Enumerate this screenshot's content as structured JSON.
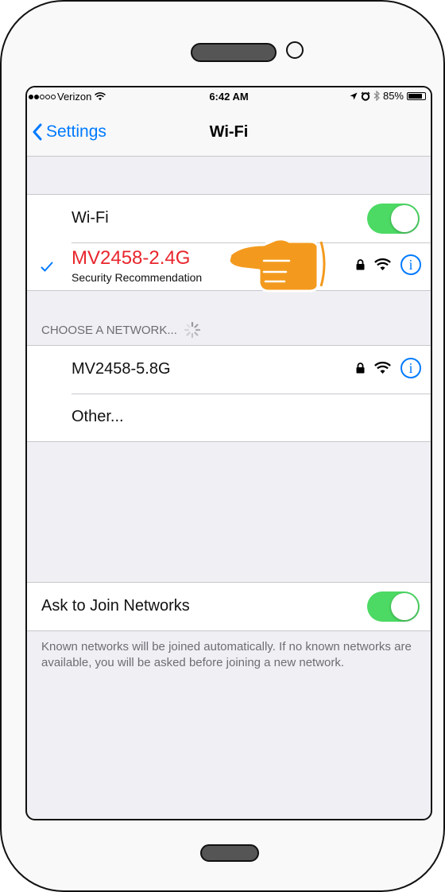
{
  "status_bar": {
    "carrier": "Verizon",
    "time": "6:42 AM",
    "battery": "85%",
    "signal_bars_filled": 2,
    "signal_bars_total": 5
  },
  "nav": {
    "back_label": "Settings",
    "title": "Wi-Fi"
  },
  "wifi_toggle": {
    "label": "Wi-Fi",
    "on": true
  },
  "connected_network": {
    "name": "MV2458-2.4G",
    "subtitle": "Security Recommendation",
    "name_color": "#e8262d"
  },
  "choose_network": {
    "header": "CHOOSE A NETWORK...",
    "networks": [
      {
        "name": "MV2458-5.8G"
      }
    ],
    "other_label": "Other..."
  },
  "ask_to_join": {
    "label": "Ask to Join Networks",
    "on": true,
    "footer": "Known networks will be joined automatically. If no known networks are available, you will be asked before joining a new network."
  },
  "colors": {
    "accent": "#007aff",
    "toggle_on": "#4cd964",
    "pointer_hand": "#f39a1e",
    "group_background": "#efeff4"
  },
  "icons": [
    "signal-dots",
    "wifi-icon",
    "location-arrow-icon",
    "alarm-icon",
    "bluetooth-icon",
    "battery-icon",
    "back-chevron-icon",
    "checkmark-icon",
    "lock-icon",
    "info-icon",
    "spinner-icon",
    "pointing-hand-icon"
  ]
}
